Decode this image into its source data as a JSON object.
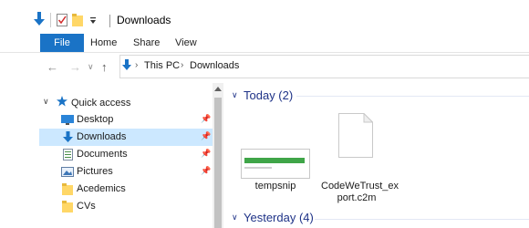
{
  "title": "Downloads",
  "ribbon": {
    "tabs": [
      "File",
      "Home",
      "Share",
      "View"
    ]
  },
  "address": {
    "crumbs": [
      "This PC",
      "Downloads"
    ]
  },
  "nav": {
    "quick_access": "Quick access",
    "items": [
      {
        "label": "Desktop",
        "icon": "desktop-icon",
        "pinned": true
      },
      {
        "label": "Downloads",
        "icon": "download-arrow-icon",
        "pinned": true,
        "selected": true
      },
      {
        "label": "Documents",
        "icon": "document-icon",
        "pinned": true
      },
      {
        "label": "Pictures",
        "icon": "pictures-icon",
        "pinned": true
      },
      {
        "label": "Acedemics",
        "icon": "folder-icon",
        "pinned": false
      },
      {
        "label": "CVs",
        "icon": "folder-icon",
        "pinned": false
      }
    ]
  },
  "content": {
    "groups": [
      {
        "label": "Today (2)"
      },
      {
        "label": "Yesterday (4)"
      }
    ],
    "files": [
      {
        "name": "tempsnip",
        "icon": "screenshot-thumbnail"
      },
      {
        "name_line1": "CodeWeTrust_ex",
        "name_line2": "port.c2m",
        "icon": "blank-file-icon"
      }
    ]
  },
  "colors": {
    "accent": "#1a73c6",
    "selection": "#cce8ff",
    "group_header": "#1e3287"
  }
}
